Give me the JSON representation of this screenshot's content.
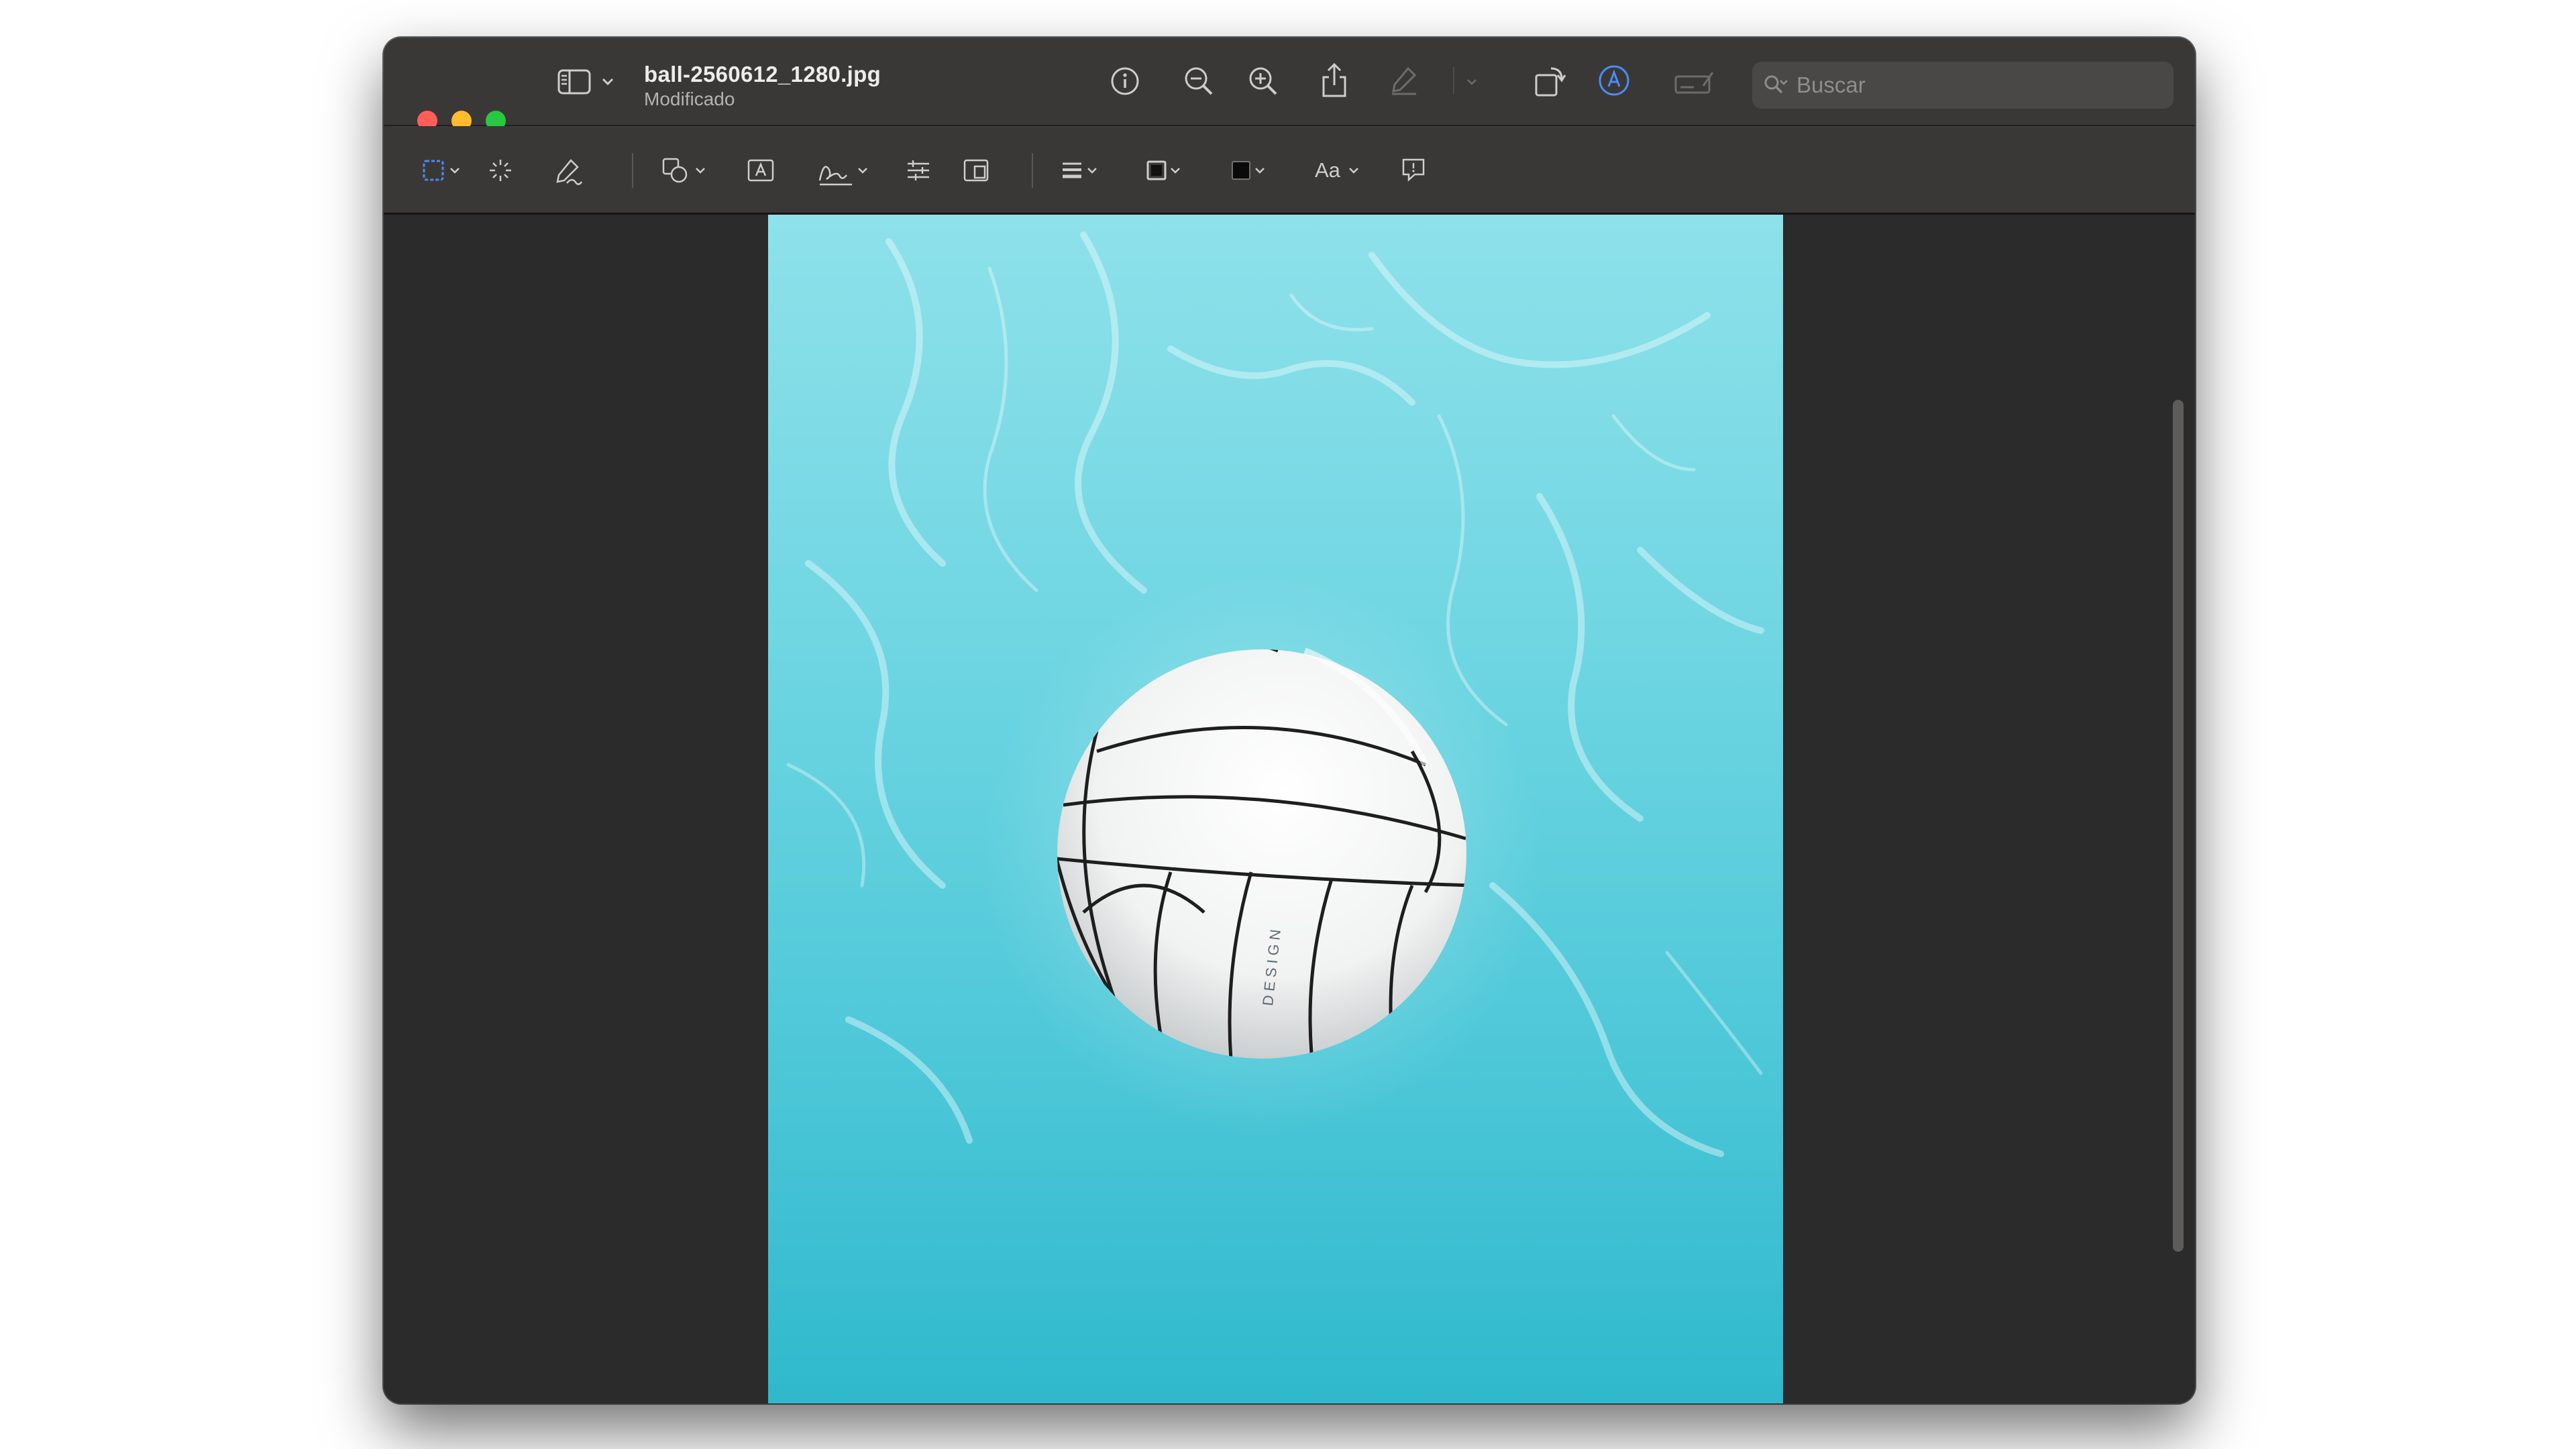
{
  "window": {
    "filename": "ball-2560612_1280.jpg",
    "status": "Modificado"
  },
  "search": {
    "placeholder": "Buscar"
  },
  "toolbar": {
    "icons": [
      "sidebar-icon",
      "info-icon",
      "zoom-out-icon",
      "zoom-in-icon",
      "share-icon",
      "highlight-pen-icon",
      "rotate-icon",
      "markup-icon",
      "form-fill-icon"
    ]
  },
  "markup_toolbar": {
    "text_style_label": "Aa",
    "icons": [
      "rect-select-icon",
      "instant-alpha-icon",
      "sketch-icon",
      "shapes-icon",
      "text-box-icon",
      "signature-icon",
      "adjust-color-icon",
      "adjust-size-icon",
      "shape-style-icon",
      "border-color-icon",
      "fill-color-icon",
      "text-style-icon",
      "note-icon"
    ]
  },
  "colors": {
    "red": "#ff5f57",
    "yellow": "#febc2e",
    "green": "#28c840",
    "accent_blue": "#4a8cf7",
    "water": "#5ccfdc"
  },
  "image": {
    "ball_text": "DESIGN"
  }
}
